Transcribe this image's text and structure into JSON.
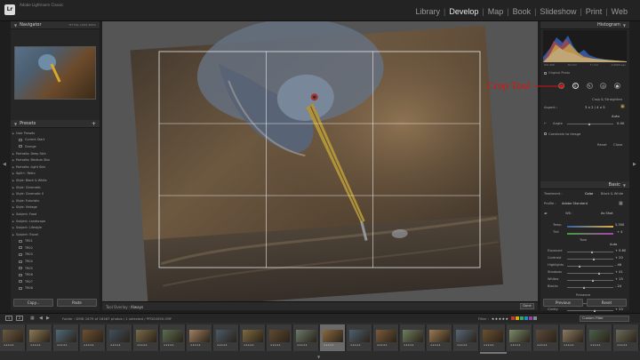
{
  "app": {
    "logo_text": "Lr",
    "title": "Adobe Lightroom Classic"
  },
  "modules": [
    {
      "label": "Library",
      "active": false
    },
    {
      "label": "Develop",
      "active": true
    },
    {
      "label": "Map",
      "active": false
    },
    {
      "label": "Book",
      "active": false
    },
    {
      "label": "Slideshow",
      "active": false
    },
    {
      "label": "Print",
      "active": false
    },
    {
      "label": "Web",
      "active": false
    }
  ],
  "left_panel": {
    "navigator": {
      "title": "Navigator",
      "zoom_options": "FIT  FILL  100%  300%"
    },
    "presets": {
      "title": "Presets",
      "add_label": "+",
      "items": [
        {
          "label": "User Presets",
          "child": false
        },
        {
          "label": "Current Start",
          "child": true
        },
        {
          "label": "Grunge",
          "child": true
        },
        {
          "label": "Portraits: Deep Skin",
          "child": false
        },
        {
          "label": "Portraits: Medium Skin",
          "child": false
        },
        {
          "label": "Portraits: Light Skin",
          "child": false
        },
        {
          "label": "Split+: Retro",
          "child": false
        },
        {
          "label": "Style: Black & White",
          "child": false
        },
        {
          "label": "Style: Cinematic",
          "child": false
        },
        {
          "label": "Style: Cinematic II",
          "child": false
        },
        {
          "label": "Style: Futuristic",
          "child": false
        },
        {
          "label": "Style: Vintage",
          "child": false
        },
        {
          "label": "Subject: Food",
          "child": false
        },
        {
          "label": "Subject: Landscape",
          "child": false
        },
        {
          "label": "Subject: Lifestyle",
          "child": false
        },
        {
          "label": "Subject: Travel",
          "child": false
        },
        {
          "label": "TR01",
          "child": true
        },
        {
          "label": "TR02",
          "child": true
        },
        {
          "label": "TR03",
          "child": true
        },
        {
          "label": "TR04",
          "child": true
        },
        {
          "label": "TR05",
          "child": true
        },
        {
          "label": "TR06",
          "child": true
        },
        {
          "label": "TR07",
          "child": true
        },
        {
          "label": "TR08",
          "child": true
        }
      ]
    },
    "copy_label": "Copy...",
    "paste_label": "Paste"
  },
  "toolbar": {
    "overlay_label": "Tool Overlay :",
    "overlay_value": "Always",
    "done_label": "Done"
  },
  "right_panel": {
    "histogram_title": "Histogram",
    "histo_readouts": [
      "ISO 200",
      "70 mm",
      "f / 4.0",
      "1/1000 sec"
    ],
    "original_photo": "Original Photo",
    "crop": {
      "title": "Crop & Straighten",
      "aspect_label": "Aspect :",
      "aspect_value": "3 x 2  /  4 x 5",
      "auto_label": "Auto",
      "angle_label": "Angle",
      "angle_value": "0.00",
      "angle_fraction": 0.5,
      "constrain_label": "Constrain to Image",
      "reset_label": "Reset",
      "close_label": "Close"
    },
    "basic": {
      "title": "Basic",
      "treatment_label": "Treatment :",
      "color_label": "Color",
      "bw_label": "Black & White",
      "profile_label": "Profile :",
      "profile_value": "Adobe Standard",
      "wb_label": "WB :",
      "wb_value": "As Shot",
      "temp_label": "Temp",
      "temp_value": "5,350",
      "tint_label": "Tint",
      "tint_value": "+ 4",
      "tone_label": "Tone",
      "tone_auto": "Auto",
      "sliders": [
        {
          "label": "Exposure",
          "value": "+ 0.60",
          "fraction": 0.55
        },
        {
          "label": "Contrast",
          "value": "+ 20",
          "fraction": 0.6
        },
        {
          "label": "Highlights",
          "value": "- 46",
          "fraction": 0.28
        },
        {
          "label": "Shadows",
          "value": "+ 41",
          "fraction": 0.7
        },
        {
          "label": "Whites",
          "value": "+ 15",
          "fraction": 0.58
        },
        {
          "label": "Blacks",
          "value": "- 24",
          "fraction": 0.38
        }
      ],
      "presence_label": "Presence",
      "presence_sliders": [
        {
          "label": "Texture",
          "value": "0",
          "fraction": 0.5
        },
        {
          "label": "Clarity",
          "value": "+ 23",
          "fraction": 0.62
        },
        {
          "label": "Dehaze",
          "value": "0",
          "fraction": 0.5
        }
      ]
    },
    "previous_label": "Previous",
    "reset_label": "Reset"
  },
  "annotation": {
    "crop_tool_label": "Crop Tool"
  },
  "filmstrip_bar": {
    "screen1": "1",
    "screen2": "2",
    "folder_info": "Folder : DMD     1679 of 16467 photos / 1 selected / PFD04950.ORF",
    "filter_label": "Filter :",
    "filter_stars": "★★★★★",
    "swatches": [
      "#c0392b",
      "#d4ac0d",
      "#27ae60",
      "#2e86c1",
      "#8e44ad",
      "#7f8c8d"
    ],
    "custom_filter": "Custom Filter"
  },
  "filmstrip": {
    "stars": "★★★★★",
    "selected_index": 12,
    "thumbs": [
      "#6b5a40",
      "#8a7a55",
      "#4f6a7a",
      "#6e5030",
      "#3f4f5f",
      "#7a6a4a",
      "#5a6f50",
      "#a08060",
      "#4a5a6a",
      "#7d6a3f",
      "#5f4a30",
      "#6a7a6a",
      "#8a6a40",
      "#4b6070",
      "#7a5a3a",
      "#6f7f5f",
      "#9a7a50",
      "#556677",
      "#6a5030",
      "#7a8a6a",
      "#5a4a3a",
      "#8a7a60",
      "#4a5f4a",
      "#6b6b5a"
    ]
  }
}
